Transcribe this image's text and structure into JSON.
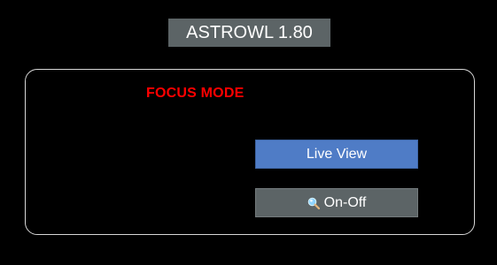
{
  "app": {
    "title": "ASTROWL 1.80"
  },
  "panel": {
    "mode_label": "FOCUS MODE"
  },
  "buttons": {
    "live_view": "Live View",
    "on_off": "On-Off"
  },
  "icons": {
    "on_off_icon": "magnifier-icon"
  },
  "colors": {
    "background": "#000000",
    "title_bg": "#5c6466",
    "mode_label": "#ff0000",
    "live_view_bg": "#4f7cc6",
    "on_off_bg": "#5c6466",
    "panel_border": "#d7d7d7"
  }
}
